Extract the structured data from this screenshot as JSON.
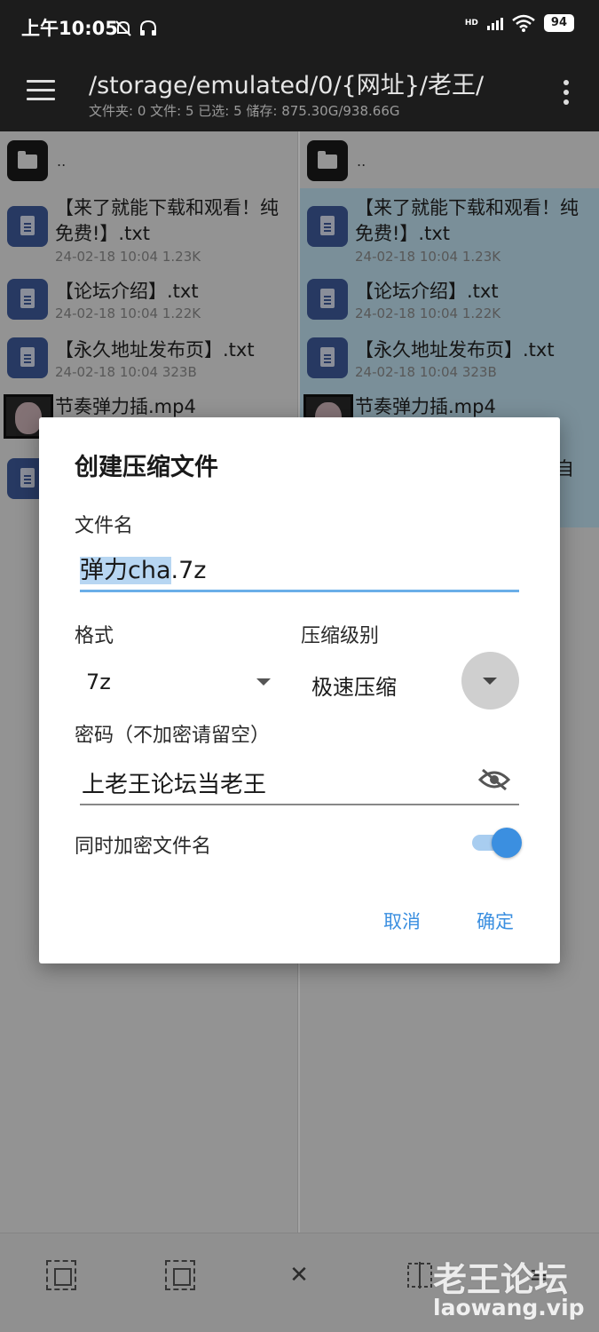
{
  "status_bar": {
    "time": "上午10:05",
    "network_badge": "HD",
    "battery": "94"
  },
  "app_bar": {
    "path": "/storage/emulated/0/{网址}/老王/",
    "info": "文件夹: 0  文件: 5  已选: 5  储存: 875.30G/938.66G"
  },
  "panes": {
    "parent_label": "..",
    "files": [
      {
        "name": "【来了就能下载和观看！纯免费!】.txt",
        "meta": "24-02-18 10:04  1.23K"
      },
      {
        "name": "【论坛介绍】.txt",
        "meta": "24-02-18 10:04  1.22K"
      },
      {
        "name": "【永久地址发布页】.txt",
        "meta": "24-02-18 10:04  323B"
      },
      {
        "name": "节奏弹力插.mp4",
        "meta": ""
      }
    ],
    "right_edge_text": "自"
  },
  "dialog": {
    "title": "创建压缩文件",
    "filename_label": "文件名",
    "filename_selected": "弹力cha",
    "filename_ext": ".7z",
    "format_label": "格式",
    "format_value": "7z",
    "level_label": "压缩级别",
    "level_value": "极速压缩",
    "password_label": "密码（不加密请留空）",
    "password_value": "上老王论坛当老王",
    "encrypt_names_label": "同时加密文件名",
    "encrypt_names_on": true,
    "cancel": "取消",
    "confirm": "确定"
  },
  "watermark": {
    "title": "老王论坛",
    "url": "laowang.vip"
  },
  "colors": {
    "accent": "#3b8fe0",
    "app_bar": "#1c1c1c",
    "file_icon": "#3d5a9a",
    "selection": "#bfe0ef"
  }
}
